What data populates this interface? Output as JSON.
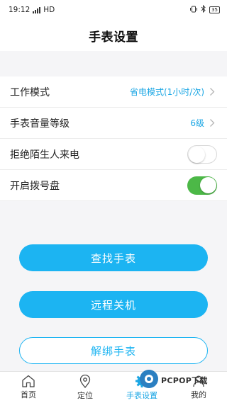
{
  "status": {
    "time": "19:12",
    "network": "HD",
    "battery": "35"
  },
  "header": {
    "title": "手表设置"
  },
  "settings": {
    "rows": [
      {
        "label": "工作模式",
        "value": "省电模式(1小时/次)"
      },
      {
        "label": "手表音量等级",
        "value": "6级"
      },
      {
        "label": "拒绝陌生人来电",
        "toggle": false
      },
      {
        "label": "开启拨号盘",
        "toggle": true
      }
    ]
  },
  "actions": {
    "find_watch": "查找手表",
    "remote_shutdown": "远程关机",
    "unbind_watch": "解绑手表"
  },
  "tabs": [
    {
      "label": "首页",
      "icon": "home-icon"
    },
    {
      "label": "定位",
      "icon": "location-pin-icon"
    },
    {
      "label": "手表设置",
      "icon": "gear-icon",
      "active": true
    },
    {
      "label": "我的",
      "icon": "user-icon"
    }
  ],
  "watermark": {
    "text": "PCPOP下载"
  },
  "colors": {
    "accent": "#1cb4f2",
    "toggle_on": "#4cb847",
    "value_text": "#1aa6e4"
  }
}
